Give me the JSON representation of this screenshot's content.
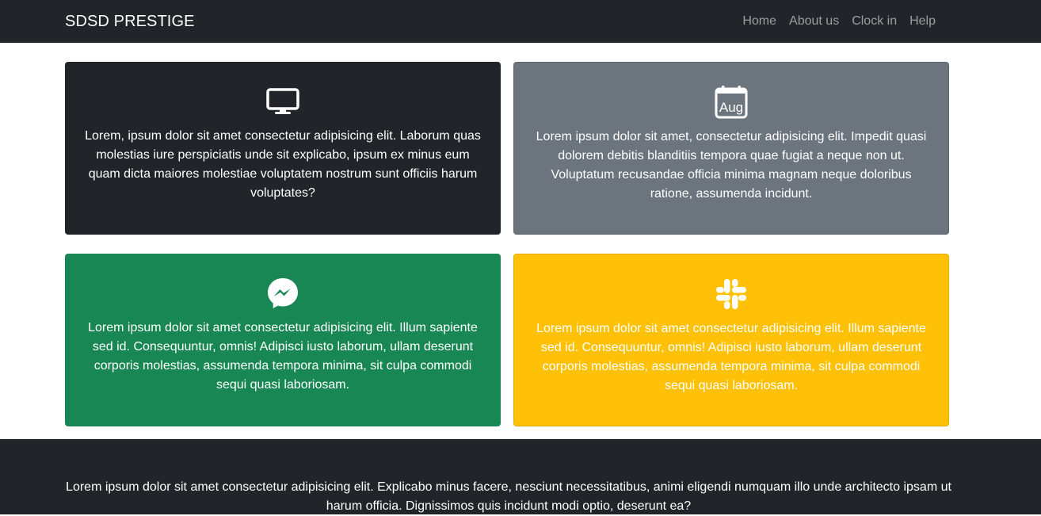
{
  "navbar": {
    "brand": "SDSD PRESTIGE",
    "links": [
      "Home",
      "About us",
      "Clock in",
      "Help"
    ]
  },
  "cards": [
    {
      "icon": "monitor-icon",
      "color": "#212529",
      "text": "Lorem, ipsum dolor sit amet consectetur adipisicing elit. Laborum quas molestias iure perspiciatis unde sit explicabo, ipsum ex minus eum quam dicta maiores molestiae voluptatem nostrum sunt officiis harum voluptates?"
    },
    {
      "icon": "calendar-icon",
      "icon_label": "Aug",
      "color": "#6c757d",
      "text": "Lorem ipsum dolor sit amet, consectetur adipisicing elit. Impedit quasi dolorem debitis blanditiis tempora quae fugiat a neque non ut. Voluptatum recusandae officia minima magnam neque doloribus ratione, assumenda incidunt."
    },
    {
      "icon": "messenger-icon",
      "color": "#198754",
      "text": "Lorem ipsum dolor sit amet consectetur adipisicing elit. Illum sapiente sed id. Consequuntur, omnis! Adipisci iusto laborum, ullam deserunt corporis molestias, assumenda tempora minima, sit culpa commodi sequi quasi laboriosam."
    },
    {
      "icon": "slack-icon",
      "color": "#ffc107",
      "text": "Lorem ipsum dolor sit amet consectetur adipisicing elit. Illum sapiente sed id. Consequuntur, omnis! Adipisci iusto laborum, ullam deserunt corporis molestias, assumenda tempora minima, sit culpa commodi sequi quasi laboriosam."
    }
  ],
  "footer": {
    "text": "Lorem ipsum dolor sit amet consectetur adipisicing elit. Explicabo minus facere, nesciunt necessitatibus, animi eligendi numquam illo unde architecto ipsam ut harum officia. Dignissimos quis incidunt modi optio, deserunt ea?"
  }
}
